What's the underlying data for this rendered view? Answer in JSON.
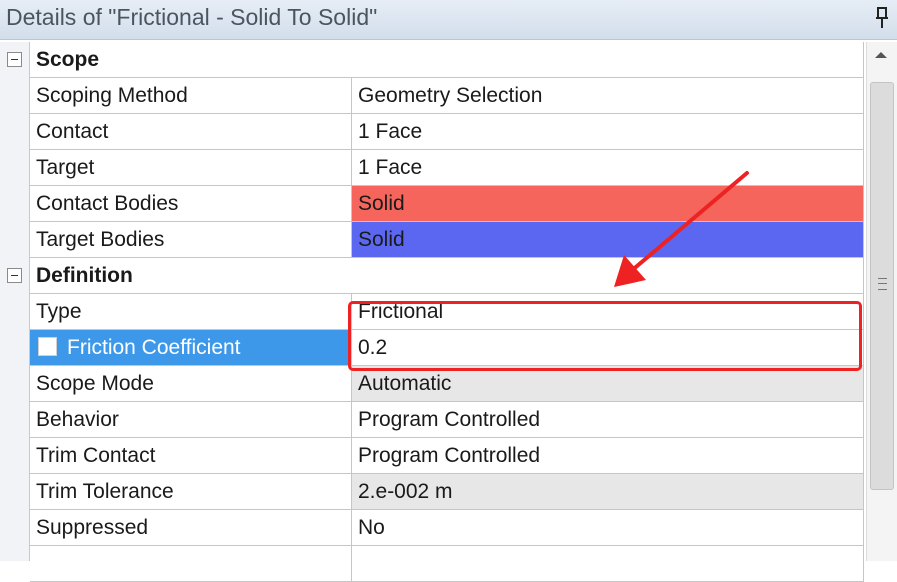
{
  "window": {
    "title": "Details of \"Frictional - Solid To Solid\""
  },
  "icons": {
    "pin": "pin-icon",
    "collapse": "minus-box-icon",
    "arrow": "red-arrow-icon"
  },
  "colors": {
    "contact_bodies": "#f5655b",
    "target_bodies": "#5b67f0",
    "selection": "#3d98ea",
    "highlight": "#ee2222"
  },
  "sections": {
    "scope": {
      "header": "Scope",
      "rows": [
        {
          "label": "Scoping Method",
          "value": "Geometry Selection"
        },
        {
          "label": "Contact",
          "value": "1 Face"
        },
        {
          "label": "Target",
          "value": "1 Face"
        },
        {
          "label": "Contact Bodies",
          "value": "Solid"
        },
        {
          "label": "Target Bodies",
          "value": "Solid"
        }
      ]
    },
    "definition": {
      "header": "Definition",
      "rows": [
        {
          "label": "Type",
          "value": "Frictional"
        },
        {
          "label": "Friction Coefficient",
          "value": "0.2"
        },
        {
          "label": "Scope Mode",
          "value": "Automatic"
        },
        {
          "label": "Behavior",
          "value": "Program Controlled"
        },
        {
          "label": "Trim Contact",
          "value": "Program Controlled"
        },
        {
          "label": "Trim Tolerance",
          "value": "2.e-002 m"
        },
        {
          "label": "Suppressed",
          "value": "No"
        }
      ]
    }
  }
}
